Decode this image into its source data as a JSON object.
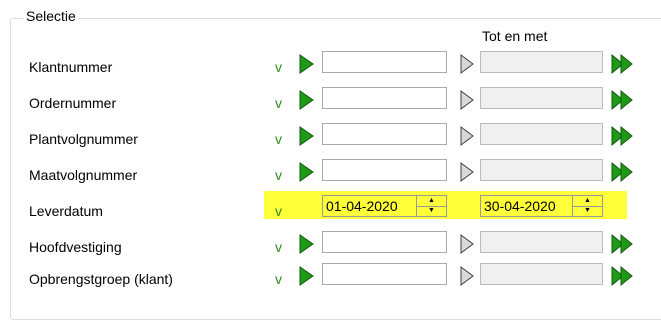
{
  "group": {
    "title": "Selectie"
  },
  "columns": {
    "to_header": "Tot en met"
  },
  "rows": [
    {
      "label": "Klantnummer",
      "v": "v",
      "from": "",
      "to": ""
    },
    {
      "label": "Ordernummer",
      "v": "v",
      "from": "",
      "to": ""
    },
    {
      "label": "Plantvolgnummer",
      "v": "v",
      "from": "",
      "to": ""
    },
    {
      "label": "Maatvolgnummer",
      "v": "v",
      "from": "",
      "to": ""
    },
    {
      "label": "Leverdatum",
      "v": "v",
      "from": "01-04-2020",
      "to": "30-04-2020"
    },
    {
      "label": "Hoofdvestiging",
      "v": "v",
      "from": "",
      "to": ""
    },
    {
      "label": "Opbrengstgroep (klant)",
      "v": "v",
      "from": "",
      "to": ""
    }
  ],
  "icons": {
    "from_button": "play-icon",
    "to_button": "play-outline-icon",
    "last_button": "fast-forward-icon"
  },
  "colors": {
    "highlight": "#ffff3a",
    "accent_green": "#1f9a16",
    "check_v": "#2f8a1f"
  }
}
